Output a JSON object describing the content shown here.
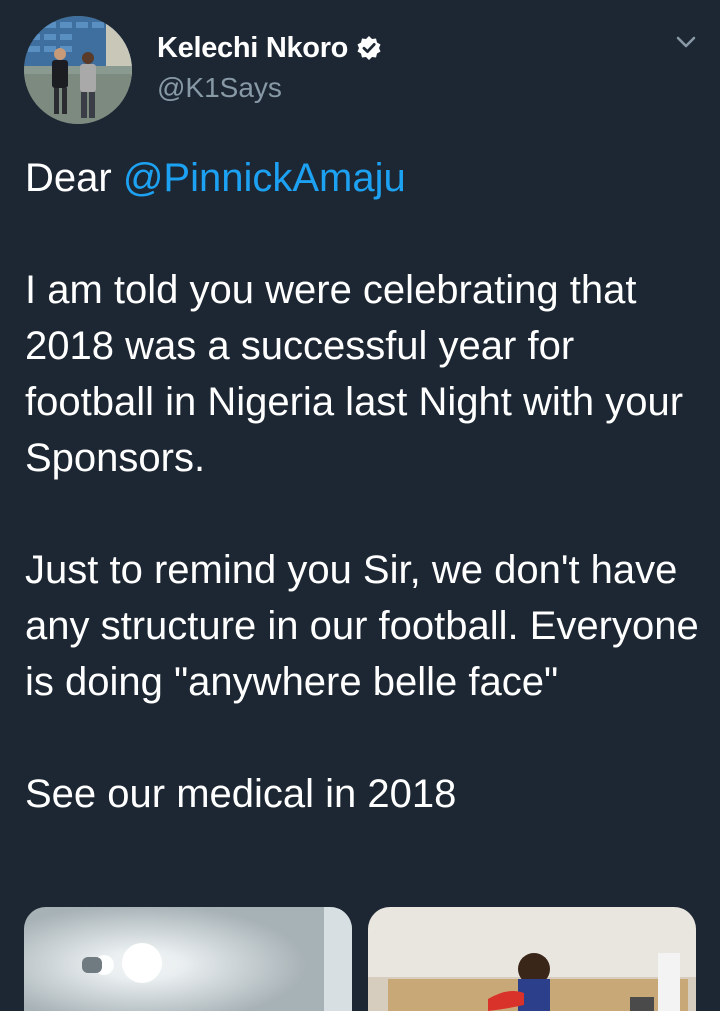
{
  "author": {
    "display_name": "Kelechi Nkoro",
    "handle": "@K1Says",
    "verified": true,
    "avatar_icon": "profile-photo"
  },
  "menu": {
    "icon": "chevron-down-icon"
  },
  "tweet": {
    "greeting": "Dear ",
    "mention": "@PinnickAmaju",
    "paragraph_1": "I am told you were celebrating that 2018 was a successful year for football in Nigeria last Night with your Sponsors.",
    "paragraph_2": "Just to remind you Sir, we don't have any structure in our football. Everyone is doing \"anywhere belle face\"",
    "paragraph_3": "See our medical in 2018"
  },
  "media": [
    {
      "icon": "photo-ceiling-light"
    },
    {
      "icon": "photo-patient-in-bed"
    }
  ],
  "colors": {
    "background": "#1c2733",
    "text": "#ffffff",
    "secondary_text": "#8899a6",
    "link": "#1da1f2"
  }
}
